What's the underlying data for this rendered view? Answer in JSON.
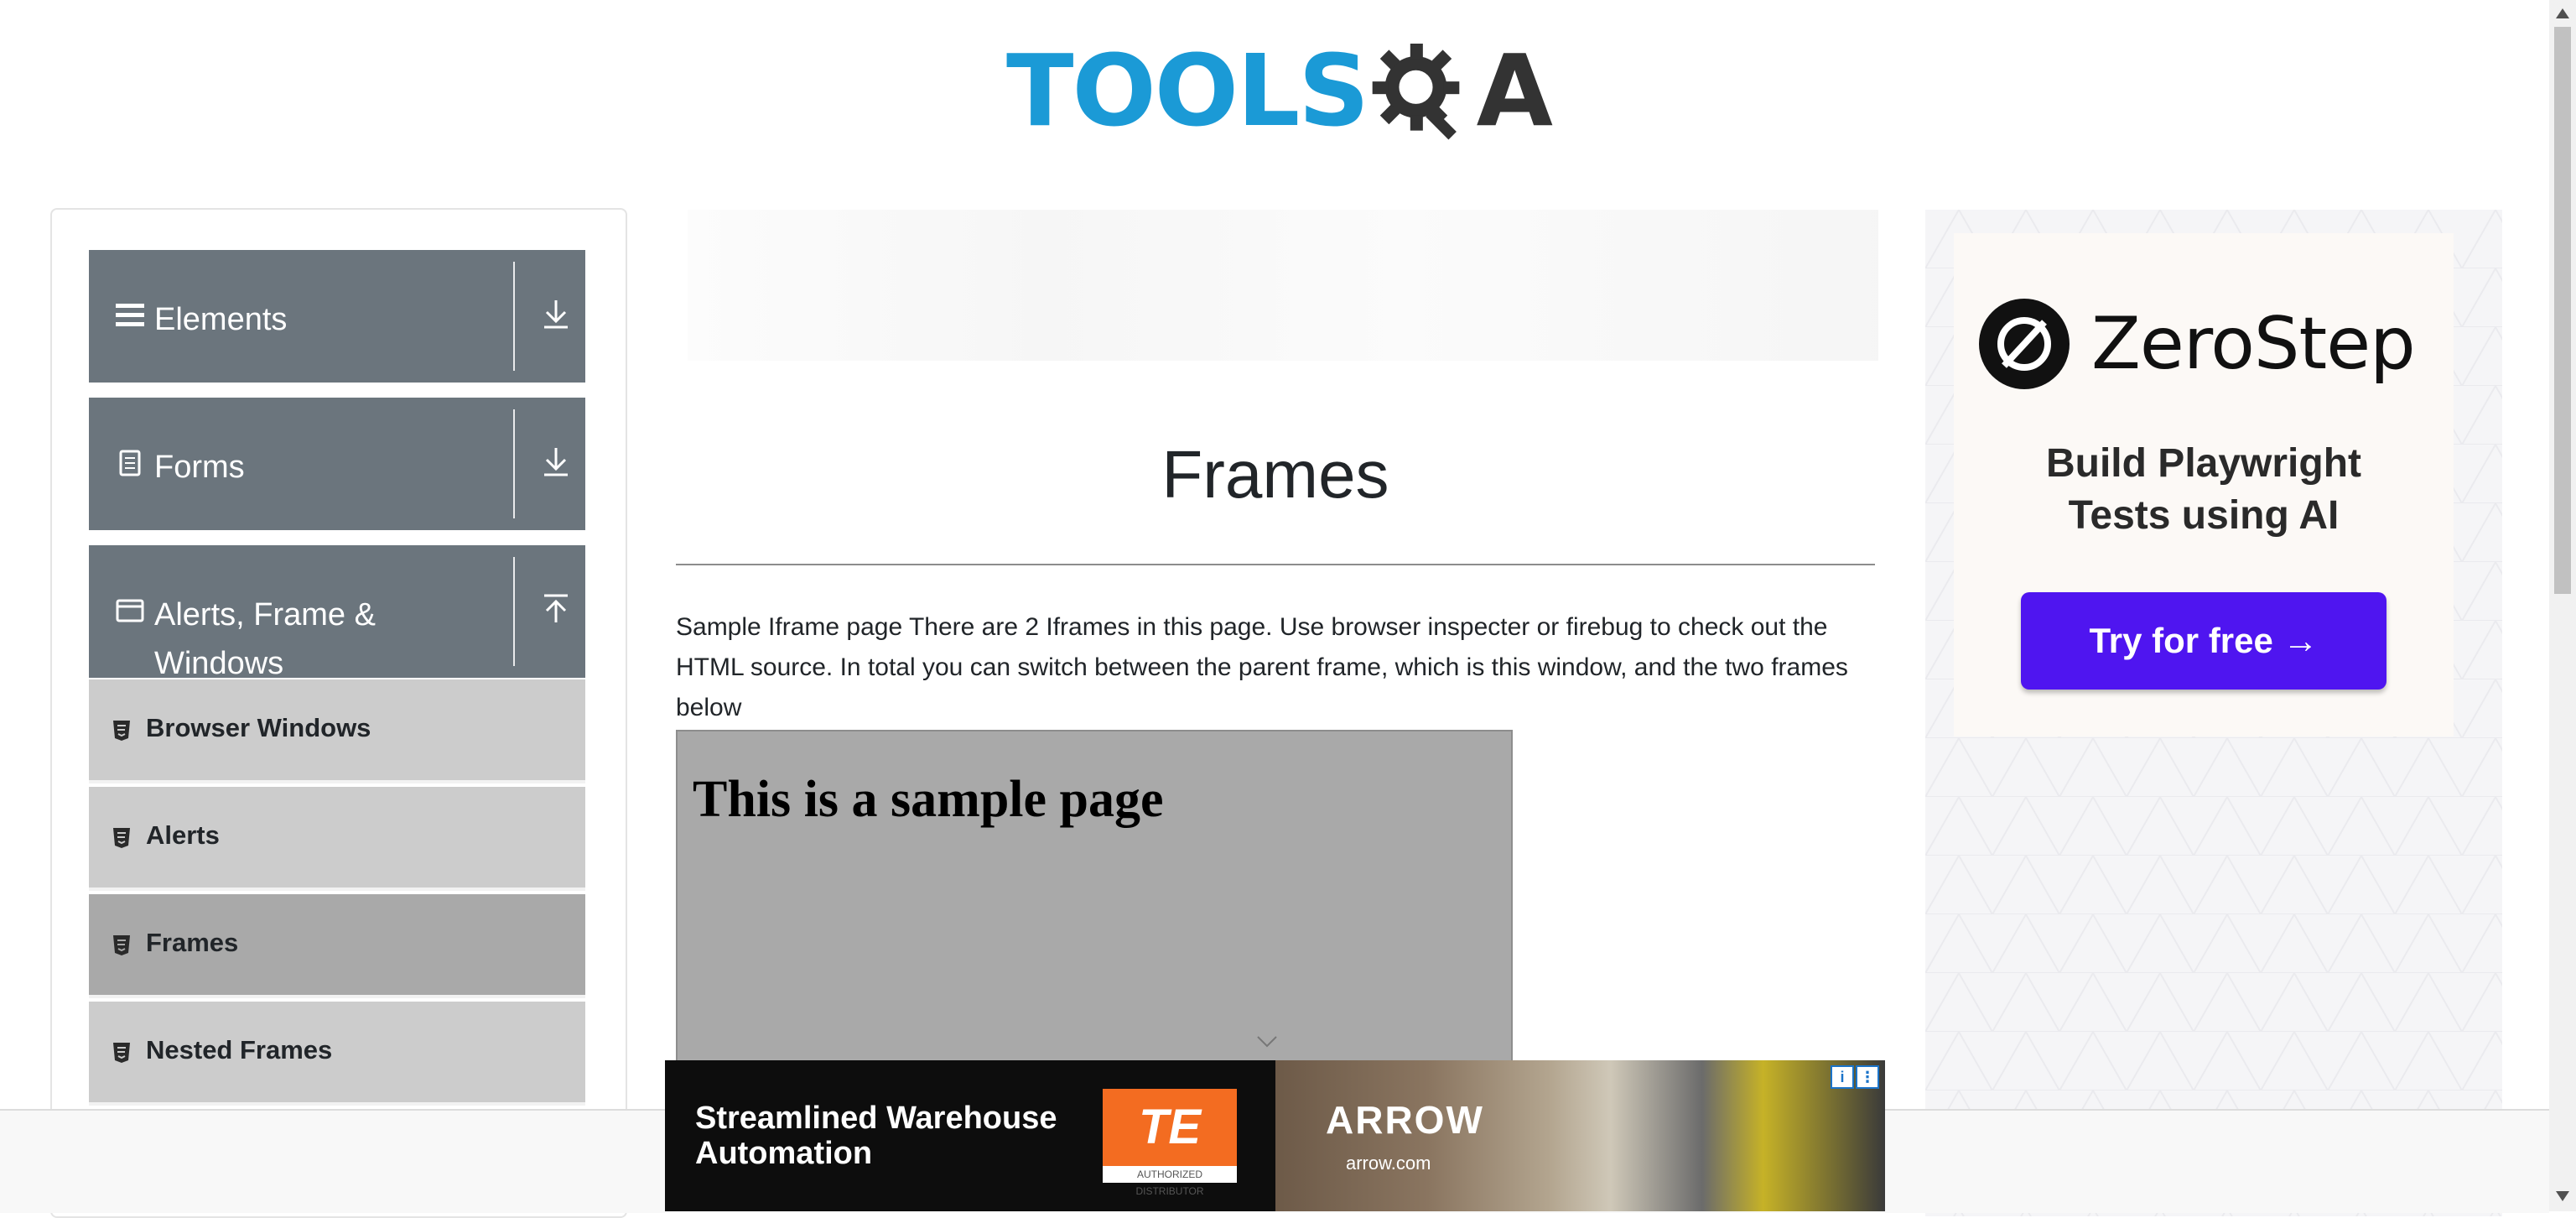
{
  "header": {
    "logo_text": "TOOLS",
    "logo_suffix": "A"
  },
  "sidebar": {
    "groups": [
      {
        "label": "Elements",
        "icon": "list-icon",
        "state": "collapsed"
      },
      {
        "label": "Forms",
        "icon": "document-icon",
        "state": "collapsed"
      },
      {
        "label": "Alerts, Frame &",
        "label_line2": "Windows",
        "icon": "window-icon",
        "state": "expanded"
      }
    ],
    "items": [
      {
        "label": "Browser Windows",
        "icon": "html5-icon"
      },
      {
        "label": "Alerts",
        "icon": "html5-icon"
      },
      {
        "label": "Frames",
        "icon": "html5-icon",
        "active": true
      },
      {
        "label": "Nested Frames",
        "icon": "html5-icon"
      }
    ]
  },
  "main": {
    "title": "Frames",
    "description": "Sample Iframe page There are 2 Iframes in this page. Use browser inspecter or firebug to check out the HTML source. In total you can switch between the parent frame, which is this window, and the two frames below",
    "iframe": {
      "heading": "This is a sample page"
    }
  },
  "right_ad": {
    "brand": "ZeroStep",
    "tagline_line1": "Build Playwright",
    "tagline_line2": "Tests using AI",
    "cta": "Try for free →",
    "cta_color": "#4f15f0"
  },
  "bottom_ad": {
    "line1": "Streamlined Warehouse",
    "line2": "Automation",
    "te_logo": "TE",
    "te_sub": "AUTHORIZED DISTRIBUTOR",
    "arrow_logo": "ARROW",
    "arrow_url": "arrow.com",
    "info_icon": "i",
    "close_icon": "⋮"
  },
  "colors": {
    "accent": "#1b9ad6",
    "sidebar_header": "#6b757d",
    "sidebar_item": "#cccccc",
    "sidebar_active": "#a9a9a9"
  }
}
